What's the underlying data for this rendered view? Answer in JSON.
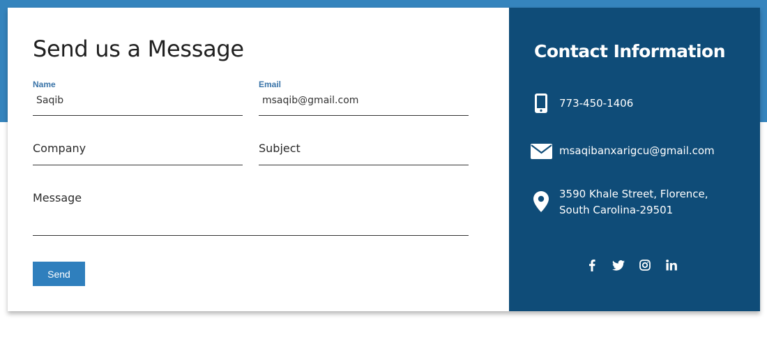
{
  "form": {
    "title": "Send us a Message",
    "name": {
      "label": "Name",
      "value": "Saqib"
    },
    "email": {
      "label": "Email",
      "value": "msaqib@gmail.com"
    },
    "company": {
      "placeholder": "Company"
    },
    "subject": {
      "placeholder": "Subject"
    },
    "message": {
      "placeholder": "Message"
    },
    "send_label": "Send"
  },
  "contact": {
    "title": "Contact Information",
    "phone": "773-450-1406",
    "email": "msaqibanxarigcu@gmail.com",
    "address": "3590 Khale Street, Florence,\nSouth Carolina-29501"
  },
  "social": [
    "facebook-icon",
    "twitter-icon",
    "instagram-icon",
    "linkedin-icon"
  ],
  "colors": {
    "accent": "#3584bd",
    "panel": "#0f4c78",
    "button": "#2f7fbd",
    "label": "#3a74a8"
  }
}
